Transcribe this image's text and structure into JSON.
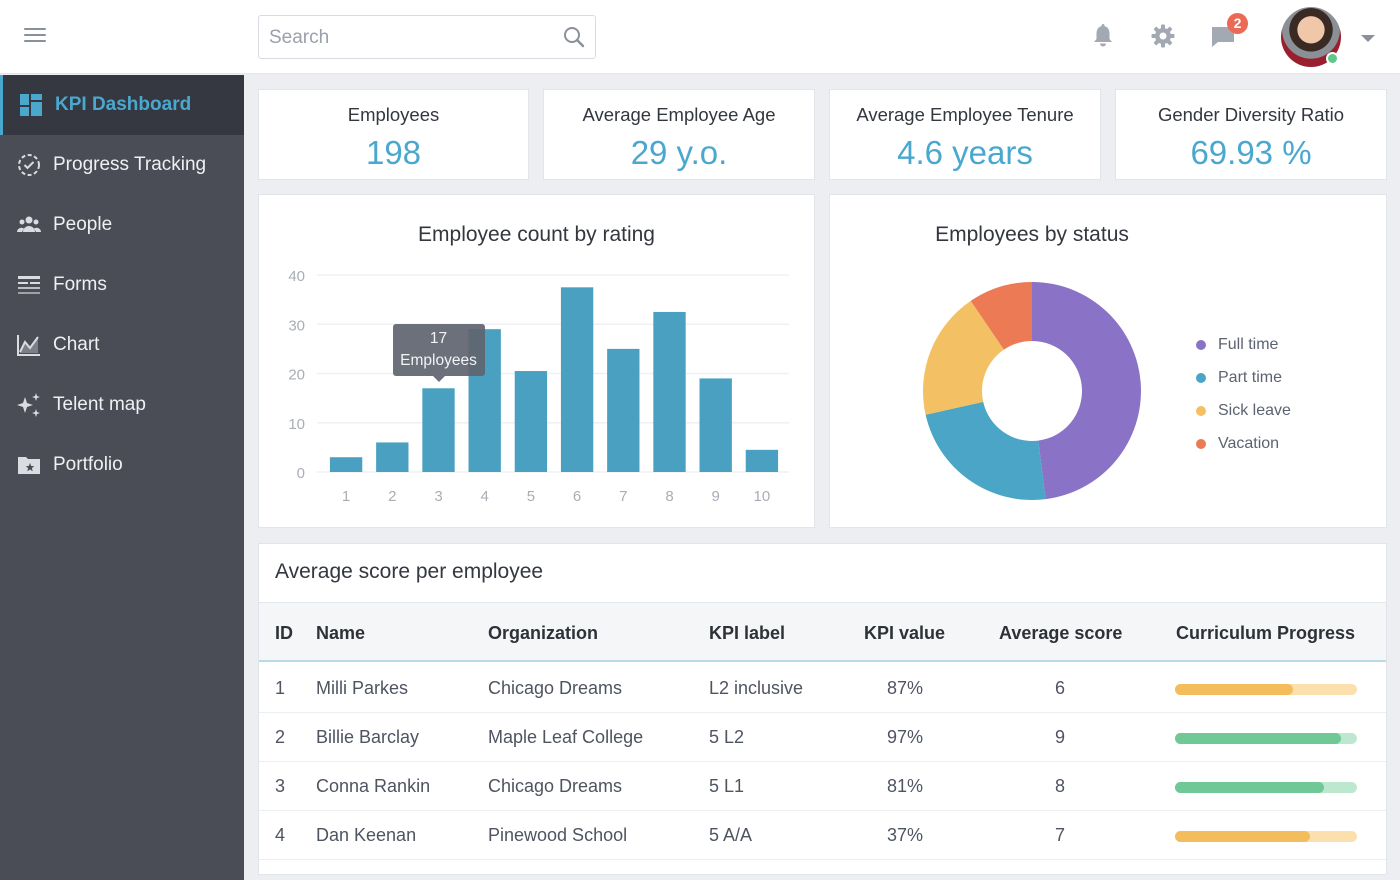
{
  "topbar": {
    "search_placeholder": "Search",
    "notification_badge": "2"
  },
  "sidebar": {
    "items": [
      {
        "label": "KPI Dashboard",
        "icon": "dashboard-icon",
        "active": true
      },
      {
        "label": "Progress Tracking",
        "icon": "progress-check-icon"
      },
      {
        "label": "People",
        "icon": "people-icon"
      },
      {
        "label": "Forms",
        "icon": "forms-icon"
      },
      {
        "label": "Chart",
        "icon": "chart-icon"
      },
      {
        "label": "Telent map",
        "icon": "sparkle-icon"
      },
      {
        "label": "Portfolio",
        "icon": "folder-star-icon"
      }
    ]
  },
  "kpis": [
    {
      "title": "Employees",
      "value": "198"
    },
    {
      "title": "Average Employee Age",
      "value": "29 y.o."
    },
    {
      "title": "Average Employee Tenure",
      "value": "4.6 years"
    },
    {
      "title": "Gender Diversity Ratio",
      "value": "69.93 %"
    }
  ],
  "chart_data": [
    {
      "type": "bar",
      "title": "Employee count by rating",
      "categories": [
        "1",
        "2",
        "3",
        "4",
        "5",
        "6",
        "7",
        "8",
        "9",
        "10"
      ],
      "values": [
        3,
        6,
        17,
        29,
        20.5,
        37.5,
        25,
        32.5,
        19,
        4.5
      ],
      "yticks": [
        "0",
        "10",
        "20",
        "30",
        "40"
      ],
      "ylim": [
        0,
        40
      ],
      "xlabel": "",
      "ylabel": "",
      "grid": true,
      "color": "#4aa0c0",
      "tooltip": {
        "category": "3",
        "value_line": "17",
        "label_line": "Employees"
      }
    },
    {
      "type": "pie",
      "title": "Employees by status",
      "donut": true,
      "legend_position": "right",
      "slices": [
        {
          "label": "Full time",
          "value": 48,
          "color": "#8a73c6"
        },
        {
          "label": "Part time",
          "value": 23.5,
          "color": "#4aa5c6"
        },
        {
          "label": "Sick leave",
          "value": 19,
          "color": "#f4c064"
        },
        {
          "label": "Vacation",
          "value": 9.5,
          "color": "#ec7a55"
        }
      ]
    }
  ],
  "table": {
    "title": "Average score per employee",
    "columns": [
      "ID",
      "Name",
      "Organization",
      "KPI label",
      "KPI value",
      "Average score",
      "Curriculum Progress"
    ],
    "rows": [
      {
        "id": "1",
        "name": "Milli Parkes",
        "org": "Chicago Dreams",
        "kpi_label": "L2 inclusive",
        "kpi_value": "87%",
        "avg_score": "6",
        "progress": 0.65,
        "progress_color": "#f4bd5c",
        "progress_track": "#fbdfad"
      },
      {
        "id": "2",
        "name": "Billie Barclay",
        "org": "Maple Leaf College",
        "kpi_label": "5 L2",
        "kpi_value": "97%",
        "avg_score": "9",
        "progress": 0.91,
        "progress_color": "#6fc896",
        "progress_track": "#bde8cf"
      },
      {
        "id": "3",
        "name": "Conna Rankin",
        "org": "Chicago Dreams",
        "kpi_label": "5 L1",
        "kpi_value": "81%",
        "avg_score": "8",
        "progress": 0.82,
        "progress_color": "#6fc896",
        "progress_track": "#bde8cf"
      },
      {
        "id": "4",
        "name": "Dan Keenan",
        "org": "Pinewood School",
        "kpi_label": "5 A/A",
        "kpi_value": "37%",
        "avg_score": "7",
        "progress": 0.74,
        "progress_color": "#f4bd5c",
        "progress_track": "#fbdfad"
      }
    ]
  }
}
